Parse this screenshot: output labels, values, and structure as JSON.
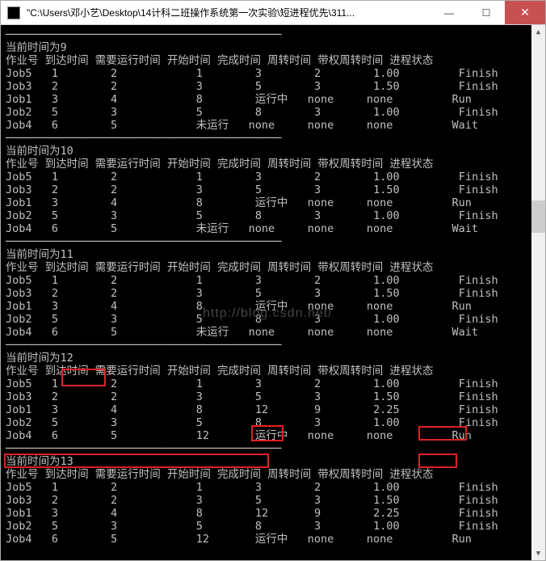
{
  "window": {
    "title": "\"C:\\Users\\邓小艺\\Desktop\\14计科二班操作系统第一次实验\\短进程优先\\311..."
  },
  "watermark": "http://blog.csdn.net/",
  "headers": {
    "job": "作业号",
    "arrive": "到达时间",
    "need": "需要运行时间",
    "start": "开始时间",
    "finish": "完成时间",
    "turnaround": "周转时间",
    "weighted": "带权周转时间",
    "state": "进程状态"
  },
  "labels": {
    "current_time_prefix": "当前时间为",
    "running": "运行中",
    "not_run": "未运行",
    "none": "none",
    "finish": "Finish",
    "run": "Run",
    "wait": "Wait"
  },
  "snapshots": [
    {
      "time": "9",
      "rows": [
        {
          "job": "Job5",
          "arrive": "1",
          "need": "2",
          "start": "1",
          "finish": "3",
          "turn": "2",
          "wturn": "1.00",
          "state": "Finish"
        },
        {
          "job": "Job3",
          "arrive": "2",
          "need": "2",
          "start": "3",
          "finish": "5",
          "turn": "3",
          "wturn": "1.50",
          "state": "Finish"
        },
        {
          "job": "Job1",
          "arrive": "3",
          "need": "4",
          "start": "8",
          "finish": "运行中",
          "turn": "none",
          "wturn": "none",
          "state": "Run"
        },
        {
          "job": "Job2",
          "arrive": "5",
          "need": "3",
          "start": "5",
          "finish": "8",
          "turn": "3",
          "wturn": "1.00",
          "state": "Finish"
        },
        {
          "job": "Job4",
          "arrive": "6",
          "need": "5",
          "start": "未运行",
          "finish": "none",
          "turn": "none",
          "wturn": "none",
          "state": "Wait"
        }
      ]
    },
    {
      "time": "10",
      "rows": [
        {
          "job": "Job5",
          "arrive": "1",
          "need": "2",
          "start": "1",
          "finish": "3",
          "turn": "2",
          "wturn": "1.00",
          "state": "Finish"
        },
        {
          "job": "Job3",
          "arrive": "2",
          "need": "2",
          "start": "3",
          "finish": "5",
          "turn": "3",
          "wturn": "1.50",
          "state": "Finish"
        },
        {
          "job": "Job1",
          "arrive": "3",
          "need": "4",
          "start": "8",
          "finish": "运行中",
          "turn": "none",
          "wturn": "none",
          "state": "Run"
        },
        {
          "job": "Job2",
          "arrive": "5",
          "need": "3",
          "start": "5",
          "finish": "8",
          "turn": "3",
          "wturn": "1.00",
          "state": "Finish"
        },
        {
          "job": "Job4",
          "arrive": "6",
          "need": "5",
          "start": "未运行",
          "finish": "none",
          "turn": "none",
          "wturn": "none",
          "state": "Wait"
        }
      ]
    },
    {
      "time": "11",
      "rows": [
        {
          "job": "Job5",
          "arrive": "1",
          "need": "2",
          "start": "1",
          "finish": "3",
          "turn": "2",
          "wturn": "1.00",
          "state": "Finish"
        },
        {
          "job": "Job3",
          "arrive": "2",
          "need": "2",
          "start": "3",
          "finish": "5",
          "turn": "3",
          "wturn": "1.50",
          "state": "Finish"
        },
        {
          "job": "Job1",
          "arrive": "3",
          "need": "4",
          "start": "8",
          "finish": "运行中",
          "turn": "none",
          "wturn": "none",
          "state": "Run"
        },
        {
          "job": "Job2",
          "arrive": "5",
          "need": "3",
          "start": "5",
          "finish": "8",
          "turn": "3",
          "wturn": "1.00",
          "state": "Finish"
        },
        {
          "job": "Job4",
          "arrive": "6",
          "need": "5",
          "start": "未运行",
          "finish": "none",
          "turn": "none",
          "wturn": "none",
          "state": "Wait"
        }
      ]
    },
    {
      "time": "12",
      "rows": [
        {
          "job": "Job5",
          "arrive": "1",
          "need": "2",
          "start": "1",
          "finish": "3",
          "turn": "2",
          "wturn": "1.00",
          "state": "Finish"
        },
        {
          "job": "Job3",
          "arrive": "2",
          "need": "2",
          "start": "3",
          "finish": "5",
          "turn": "3",
          "wturn": "1.50",
          "state": "Finish"
        },
        {
          "job": "Job1",
          "arrive": "3",
          "need": "4",
          "start": "8",
          "finish": "12",
          "turn": "9",
          "wturn": "2.25",
          "state": "Finish"
        },
        {
          "job": "Job2",
          "arrive": "5",
          "need": "3",
          "start": "5",
          "finish": "8",
          "turn": "3",
          "wturn": "1.00",
          "state": "Finish"
        },
        {
          "job": "Job4",
          "arrive": "6",
          "need": "5",
          "start": "12",
          "finish": "运行中",
          "turn": "none",
          "wturn": "none",
          "state": "Run"
        }
      ]
    },
    {
      "time": "13",
      "rows": [
        {
          "job": "Job5",
          "arrive": "1",
          "need": "2",
          "start": "1",
          "finish": "3",
          "turn": "2",
          "wturn": "1.00",
          "state": "Finish"
        },
        {
          "job": "Job3",
          "arrive": "2",
          "need": "2",
          "start": "3",
          "finish": "5",
          "turn": "3",
          "wturn": "1.50",
          "state": "Finish"
        },
        {
          "job": "Job1",
          "arrive": "3",
          "need": "4",
          "start": "8",
          "finish": "12",
          "turn": "9",
          "wturn": "2.25",
          "state": "Finish"
        },
        {
          "job": "Job2",
          "arrive": "5",
          "need": "3",
          "start": "5",
          "finish": "8",
          "turn": "3",
          "wturn": "1.00",
          "state": "Finish"
        },
        {
          "job": "Job4",
          "arrive": "6",
          "need": "5",
          "start": "12",
          "finish": "运行中",
          "turn": "none",
          "wturn": "none",
          "state": "Run"
        }
      ]
    }
  ]
}
